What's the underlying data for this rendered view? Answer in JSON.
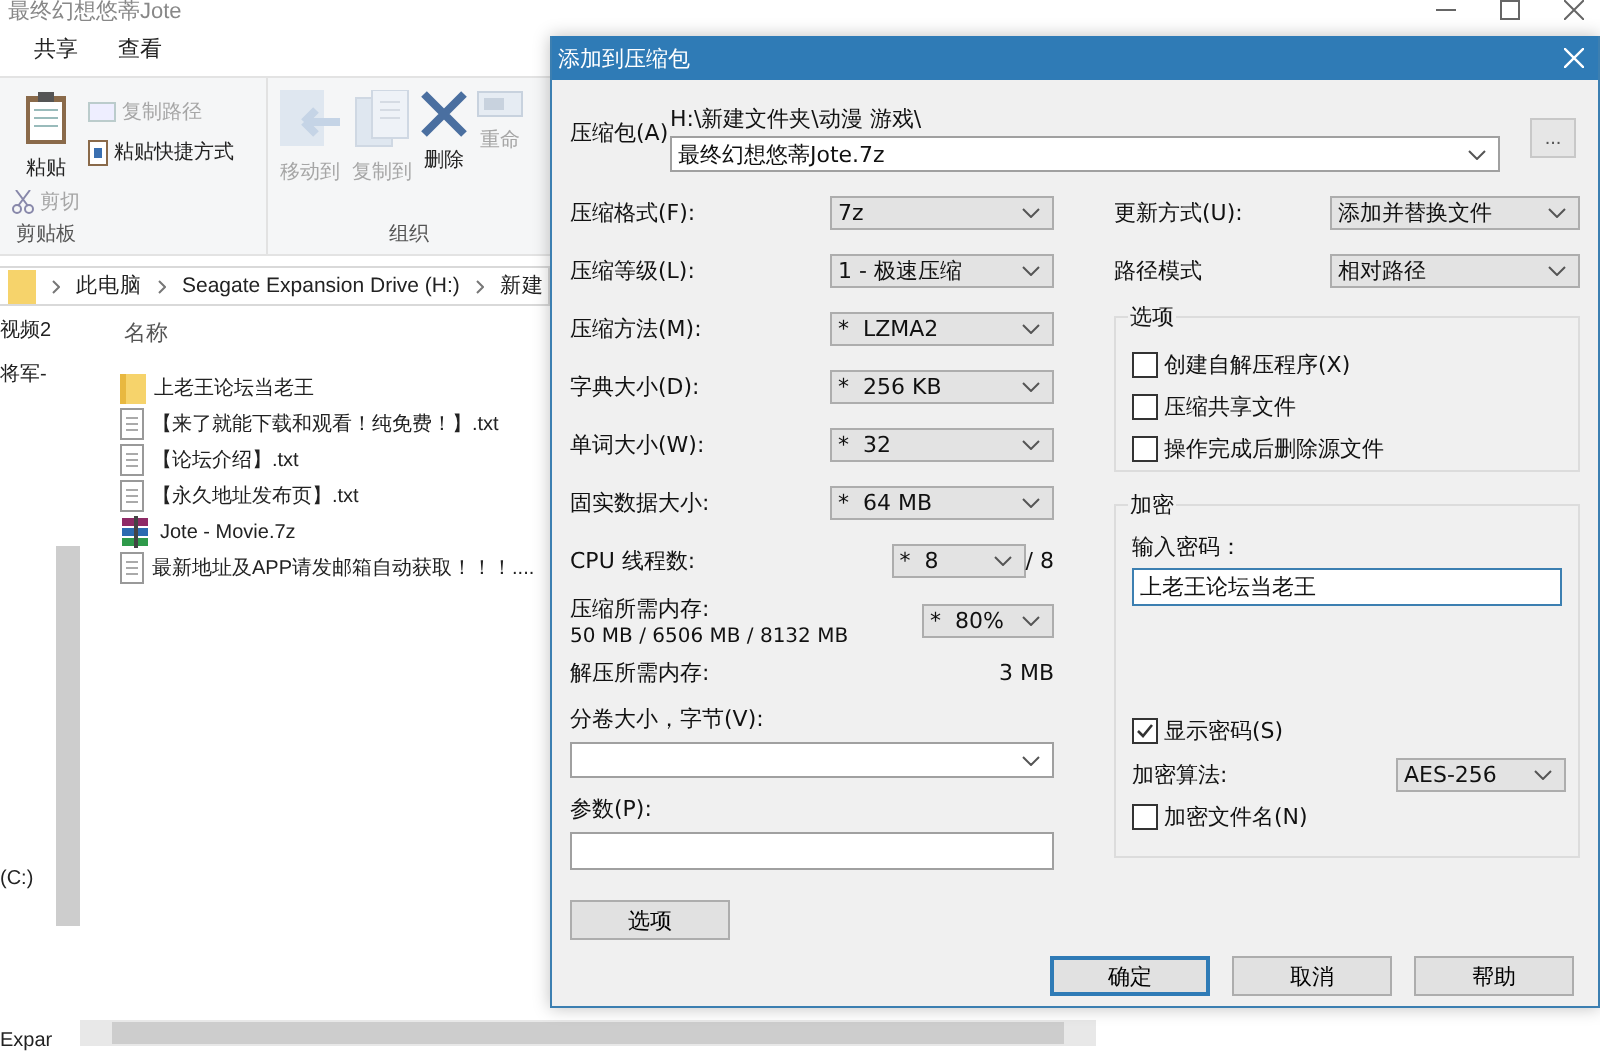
{
  "explorer": {
    "title": "最终幻想悠蒂Jote",
    "tabs": [
      {
        "label": "共享"
      },
      {
        "label": "查看"
      }
    ],
    "clipboard": {
      "paste": "粘贴",
      "copy_path": {
        "label": "复制路径",
        "disabled": true
      },
      "paste_shortcut": {
        "label": "粘贴快捷方式",
        "disabled": false
      },
      "cut": {
        "label": "剪切",
        "disabled": true
      },
      "group": "剪贴板"
    },
    "organize": {
      "buttons": [
        {
          "kind": "move",
          "label": "移动到",
          "disabled": true
        },
        {
          "kind": "copy",
          "label": "复制到",
          "disabled": true
        },
        {
          "kind": "delete",
          "label": "删除",
          "disabled": false
        },
        {
          "kind": "rename",
          "label": "重命",
          "disabled": true
        }
      ],
      "group": "组织"
    },
    "address": [
      "此电脑",
      "Seagate Expansion Drive (H:)",
      "新建"
    ],
    "nav_pane": [
      "视频2",
      "将军-",
      "(C:)",
      "Expar"
    ],
    "column": "名称",
    "files": [
      {
        "kind": "folder",
        "name": "上老王论坛当老王"
      },
      {
        "kind": "text",
        "name": "【来了就能下载和观看！纯免费！】.txt"
      },
      {
        "kind": "text",
        "name": "【论坛介绍】.txt"
      },
      {
        "kind": "text",
        "name": "【永久地址发布页】.txt"
      },
      {
        "kind": "archive",
        "name": "Jote - Movie.7z"
      },
      {
        "kind": "text",
        "name": "最新地址及APP请发邮箱自动获取！！！...."
      }
    ]
  },
  "dialog": {
    "title": "添加到压缩包",
    "archive": {
      "label": "压缩包(A)",
      "path": "H:\\新建文件夹\\动漫 游戏\\",
      "value": "最终幻想悠蒂Jote.7z",
      "browse": "..."
    },
    "left": [
      {
        "kind": "select",
        "label": "压缩格式(F):",
        "value": "7z"
      },
      {
        "kind": "select",
        "label": "压缩等级(L):",
        "value": "1 - 极速压缩"
      },
      {
        "kind": "select",
        "label": "压缩方法(M):",
        "value": "*  LZMA2"
      },
      {
        "kind": "select",
        "label": "字典大小(D):",
        "value": "*  256 KB"
      },
      {
        "kind": "select",
        "label": "单词大小(W):",
        "value": "*  32"
      },
      {
        "kind": "select",
        "label": "固实数据大小:",
        "value": "*  64 MB"
      },
      {
        "kind": "cpu",
        "label": "CPU 线程数:",
        "value": "*  8",
        "suffix": "/ 8"
      },
      {
        "kind": "memory",
        "label": "压缩所需内存:",
        "detail": "50 MB / 6506 MB / 8132 MB",
        "value": "*  80%"
      },
      {
        "kind": "info",
        "label": "解压所需内存:",
        "value": "3 MB"
      },
      {
        "kind": "combo",
        "label": "分卷大小，字节(V):"
      },
      {
        "kind": "input",
        "label": "参数(P):"
      }
    ],
    "options_button": "选项",
    "right": [
      {
        "label": "更新方式(U):",
        "value": "添加并替换文件"
      },
      {
        "label": "路径模式",
        "value": "相对路径"
      }
    ],
    "options": {
      "title": "选项",
      "checks": [
        {
          "label": "创建自解压程序(X)",
          "checked": false
        },
        {
          "label": "压缩共享文件",
          "checked": false
        },
        {
          "label": "操作完成后删除源文件",
          "checked": false
        }
      ]
    },
    "encryption": {
      "title": "加密",
      "password_label": "输入密码：",
      "password": "上老王论坛当老王",
      "show_password": {
        "label": "显示密码(S)",
        "checked": true
      },
      "method_label": "加密算法:",
      "method": "AES-256",
      "encrypt_names": {
        "label": "加密文件名(N)",
        "checked": false
      }
    },
    "buttons": [
      {
        "label": "确定",
        "default": true
      },
      {
        "label": "取消",
        "default": false
      },
      {
        "label": "帮助",
        "default": false
      }
    ]
  }
}
